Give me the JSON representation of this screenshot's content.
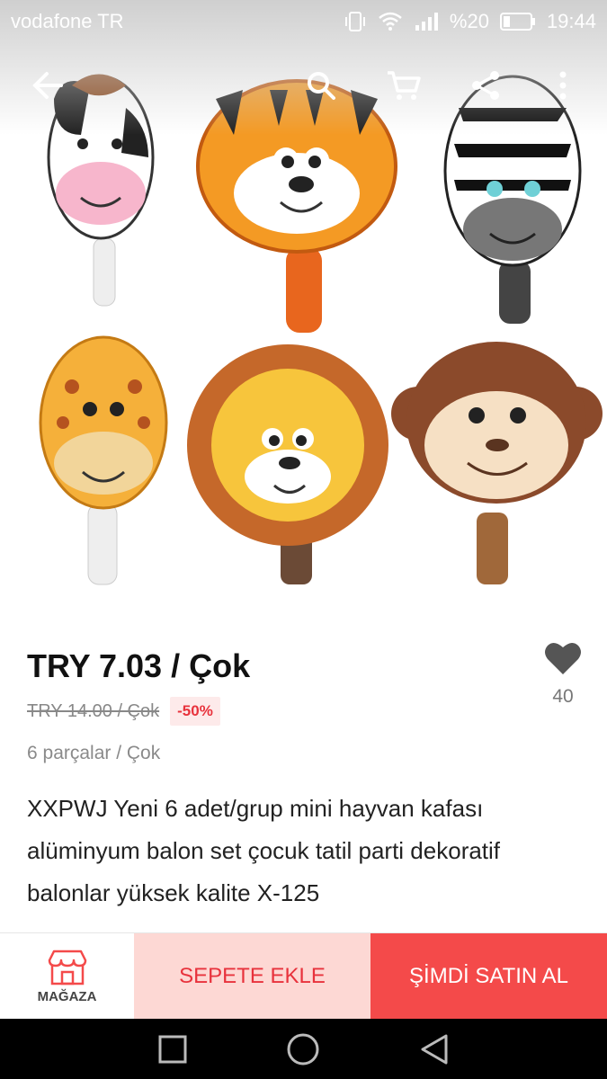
{
  "status_bar": {
    "carrier": "vodafone TR",
    "battery": "%20",
    "time": "19:44"
  },
  "icons": {
    "back": "arrow-left-icon",
    "search": "search-icon",
    "cart": "cart-icon",
    "share": "share-icon",
    "more": "more-vert-icon",
    "wishlist": "heart-icon",
    "store": "store-icon"
  },
  "product": {
    "price": "TRY 7.03 / Çok",
    "old_price": "TRY 14.00 / Çok",
    "discount": "-50%",
    "unit": "6 parçalar / Çok",
    "title": "XXPWJ Yeni 6 adet/grup mini hayvan kafası alüminyum balon set çocuk tatil parti dekoratif balonlar yüksek kalite X-125",
    "wishlist_count": "40"
  },
  "actions": {
    "store_label": "MAĞAZA",
    "add_to_cart": "SEPETE EKLE",
    "buy_now": "ŞİMDİ SATIN AL"
  },
  "colors": {
    "accent": "#f44a4a",
    "accent_light": "#fdd8d4",
    "discount_text": "#e8323c"
  }
}
